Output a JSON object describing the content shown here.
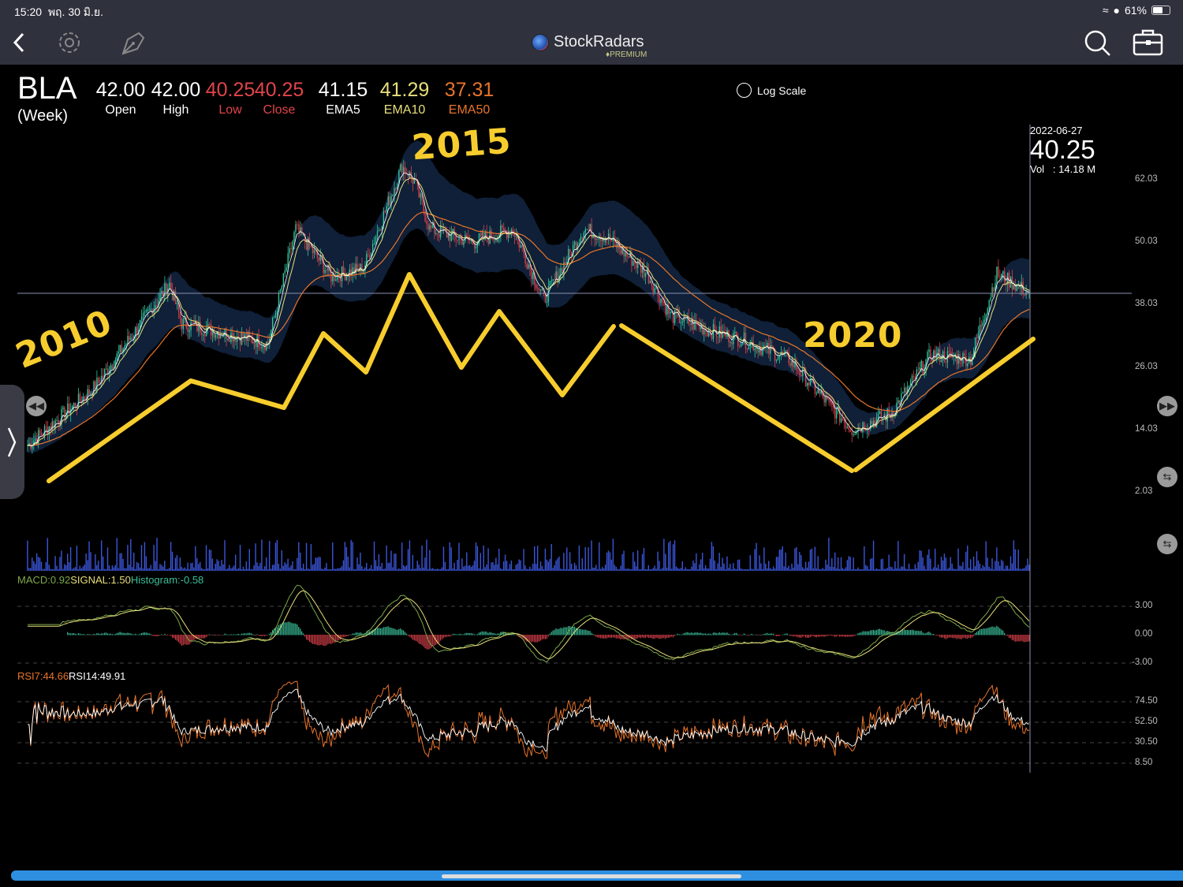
{
  "status_bar": {
    "time": "15:20",
    "date": "พฤ. 30 มิ.ย.",
    "battery": "61%",
    "battery_level": 0.61
  },
  "app": {
    "name": "StockRadars",
    "tier": "PREMIUM"
  },
  "quote": {
    "symbol": "BLA",
    "period": "(Week)",
    "fields": [
      {
        "label": "Open",
        "value": "42.00",
        "color": "#ffffff"
      },
      {
        "label": "High",
        "value": "42.00",
        "color": "#ffffff"
      },
      {
        "label": "Low",
        "value": "40.25",
        "color": "#e0444a"
      },
      {
        "label": "Close",
        "value": "40.25",
        "color": "#e0444a"
      },
      {
        "label": "EMA5",
        "value": "41.15",
        "color": "#ffffff"
      },
      {
        "label": "EMA10",
        "value": "41.29",
        "color": "#e8df7a"
      },
      {
        "label": "EMA50",
        "value": "37.31",
        "color": "#e8742a"
      }
    ]
  },
  "log_scale": {
    "label": "Log Scale",
    "checked": false
  },
  "crosshair": {
    "date": "2022-06-27",
    "price": "40.25",
    "vol_label": "Vol",
    "vol_value": ": 14.18 M"
  },
  "price_axis": [
    "62.03",
    "50.03",
    "38.03",
    "26.03",
    "14.03",
    "2.03"
  ],
  "macd": {
    "label": "MACD:0.92",
    "signal": "SIGNAL:1.50",
    "histogram": "Histogram:-0.58",
    "axis": [
      "3.00",
      "0.00",
      "-3.00"
    ]
  },
  "rsi": {
    "rsi7": "RSI7:44.66",
    "rsi14": "RSI14:49.91",
    "axis": [
      "74.50",
      "52.50",
      "30.50",
      "8.50"
    ]
  },
  "annotations": {
    "a2010": "2010",
    "a2015": "2015",
    "a2020": "2020"
  },
  "colors": {
    "up": "#2fc59a",
    "down": "#d8404a",
    "ema5": "#ffffff",
    "ema10": "#e8df7a",
    "ema50": "#e8742a",
    "band": "#0f2038",
    "annotation": "#f7cd2e",
    "volume": "#3a55d8"
  },
  "chart_data": {
    "type": "candlestick",
    "interval": "week",
    "price_path_week_price": [
      [
        0,
        11
      ],
      [
        43,
        22
      ],
      [
        92,
        42
      ],
      [
        100,
        34.5
      ],
      [
        136,
        32
      ],
      [
        156,
        30.6
      ],
      [
        174,
        52.6
      ],
      [
        197,
        43.5
      ],
      [
        218,
        45
      ],
      [
        243,
        64.7
      ],
      [
        251,
        61.7
      ],
      [
        261,
        52.6
      ],
      [
        289,
        50
      ],
      [
        315,
        52.6
      ],
      [
        335,
        39
      ],
      [
        361,
        52.6
      ],
      [
        376,
        51
      ],
      [
        402,
        44
      ],
      [
        417,
        36
      ],
      [
        443,
        33
      ],
      [
        463,
        31.4
      ],
      [
        494,
        27.6
      ],
      [
        514,
        20.8
      ],
      [
        535,
        14
      ],
      [
        560,
        17
      ],
      [
        586,
        28.4
      ],
      [
        612,
        27.6
      ],
      [
        629,
        44
      ],
      [
        650,
        40.25
      ]
    ],
    "ylim": [
      2.03,
      62.03
    ]
  }
}
